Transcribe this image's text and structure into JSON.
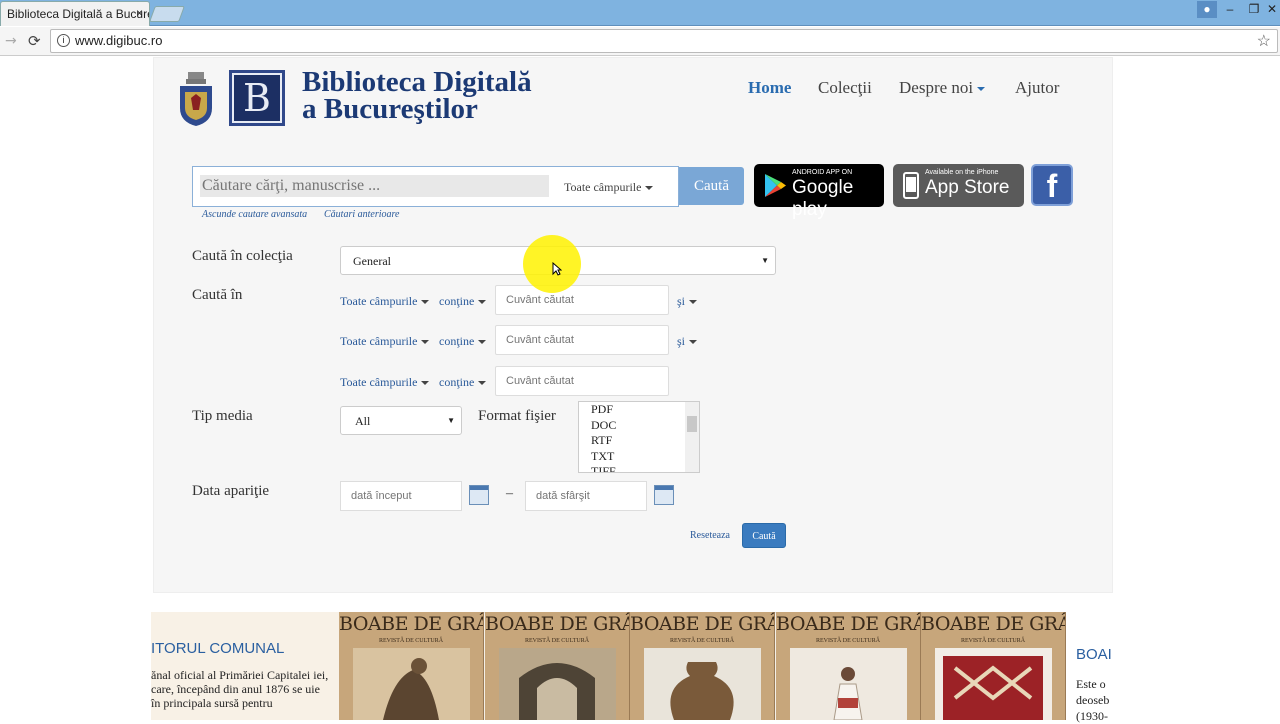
{
  "browser": {
    "tab_title": "Biblioteca Digitală a Bucureștilor",
    "tab_close": "×",
    "url": "www.digibuc.ro"
  },
  "site": {
    "title_line1": "Biblioteca Digitală",
    "title_line2": "a Bucureştilor",
    "nav": {
      "home": "Home",
      "collections": "Colecţii",
      "about": "Despre noi",
      "help": "Ajutor"
    }
  },
  "search": {
    "placeholder": "Căutare cărţi, manuscrise ...",
    "field_select": "Toate câmpurile",
    "button": "Caută",
    "hide_advanced": "Ascunde cautare avansata",
    "previous_searches": "Cǎutari anterioare"
  },
  "stores": {
    "google_small": "ANDROID APP ON",
    "google_big": "Google play",
    "apple_small": "Available on the iPhone",
    "apple_big": "App Store",
    "facebook": "f"
  },
  "advanced": {
    "collection_label": "Caută în colecţia",
    "collection_value": "General",
    "search_in_label": "Caută în",
    "rows": [
      {
        "field": "Toate câmpurile",
        "op": "conţine",
        "placeholder": "Cuvânt căutat",
        "join": "şi"
      },
      {
        "field": "Toate câmpurile",
        "op": "conţine",
        "placeholder": "Cuvânt căutat",
        "join": "şi"
      },
      {
        "field": "Toate câmpurile",
        "op": "conţine",
        "placeholder": "Cuvânt căutat",
        "join": ""
      }
    ],
    "media_label": "Tip media",
    "media_value": "All",
    "format_label": "Format fişier",
    "formats": [
      "PDF",
      "DOC",
      "RTF",
      "TXT",
      "TIFF"
    ],
    "date_label": "Data apariţie",
    "date_start_placeholder": "dată început",
    "date_separator": "–",
    "date_end_placeholder": "dată sfârşit",
    "reset": "Reseteaza",
    "submit": "Caută"
  },
  "carousel": {
    "left_title": "ITORUL COMUNAL",
    "left_text": "ănal oficial al Primăriei Capitalei iei, care, începând din anul 1876 se uie în principala sursă pentru",
    "cover_title": "BOABE DE GRÂU",
    "cover_sub": "REVISTĂ DE CULTURĂ",
    "right_title": "BOAI",
    "right_text": "Este o deoseb (1930-"
  }
}
